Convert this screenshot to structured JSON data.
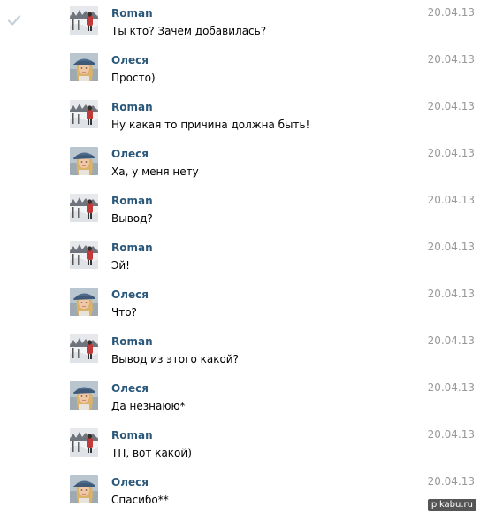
{
  "messages": [
    {
      "author": "Roman",
      "text": "Ты кто? Зачем добавилась?",
      "date": "20.04.13",
      "avatar": "roman"
    },
    {
      "author": "Олеся",
      "text": "Просто)",
      "date": "20.04.13",
      "avatar": "olesya"
    },
    {
      "author": "Roman",
      "text": "Ну какая то причина должна быть!",
      "date": "20.04.13",
      "avatar": "roman"
    },
    {
      "author": "Олеся",
      "text": "Ха, у меня нету",
      "date": "20.04.13",
      "avatar": "olesya"
    },
    {
      "author": "Roman",
      "text": "Вывод?",
      "date": "20.04.13",
      "avatar": "roman"
    },
    {
      "author": "Roman",
      "text": "Эй!",
      "date": "20.04.13",
      "avatar": "roman"
    },
    {
      "author": "Олеся",
      "text": "Что?",
      "date": "20.04.13",
      "avatar": "olesya"
    },
    {
      "author": "Roman",
      "text": "Вывод из этого какой?",
      "date": "20.04.13",
      "avatar": "roman"
    },
    {
      "author": "Олеся",
      "text": "Да незнаюю*",
      "date": "20.04.13",
      "avatar": "olesya"
    },
    {
      "author": "Roman",
      "text": "ТП, вот какой)",
      "date": "20.04.13",
      "avatar": "roman"
    },
    {
      "author": "Олеся",
      "text": "Спасибо**",
      "date": "20.04.13",
      "avatar": "olesya"
    }
  ],
  "watermark": "pikabu.ru",
  "colors": {
    "author": "#2b587a",
    "date": "#999999",
    "text": "#000000",
    "checkmark": "#c5cfd9"
  },
  "icons": {
    "read_status": "checkmark-icon"
  }
}
